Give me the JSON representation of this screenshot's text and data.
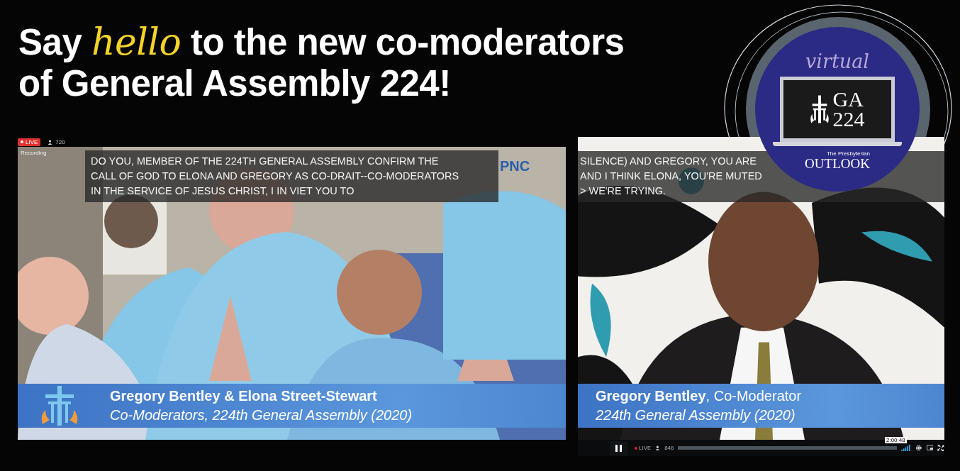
{
  "headline": {
    "lines": [
      "Say *hello* to the new co-moderators",
      "of General Assembly 224!"
    ]
  },
  "badge": {
    "script": "virtual",
    "title": "GA",
    "number": "224",
    "publisher_small": "The Presbyterian",
    "publisher": "OUTLOOK"
  },
  "left_stream": {
    "live_badge": "LIVE",
    "viewers": "720",
    "recording": "Recording",
    "sponsor": "PNC",
    "caption": [
      "DO YOU, MEMBER OF THE 224TH GENERAL ASSEMBLY CONFIRM THE",
      "CALL OF GOD TO ELONA AND GREGORY AS CO-DRAIT--CO-MODERATORS",
      "IN THE SERVICE OF JESUS CHRIST, I IN VIET YOU TO"
    ],
    "lower_third": {
      "name": "Gregory Bentley & Elona Street-Stewart",
      "title": "Co-Moderators, 224th General Assembly (2020)"
    }
  },
  "right_stream": {
    "caption": [
      "SILENCE) AND GREGORY, YOU ARE",
      "AND I THINK ELONA, YOU'RE MUTED",
      "> WE'RE TRYING."
    ],
    "lower_third": {
      "name": "**Gregory Bentley**, Co-Moderator",
      "title": "224th General Assembly (2020)"
    },
    "controls": {
      "playing": true,
      "live": "LIVE",
      "viewers": "846",
      "time": "2:00:48",
      "level": 1
    }
  }
}
